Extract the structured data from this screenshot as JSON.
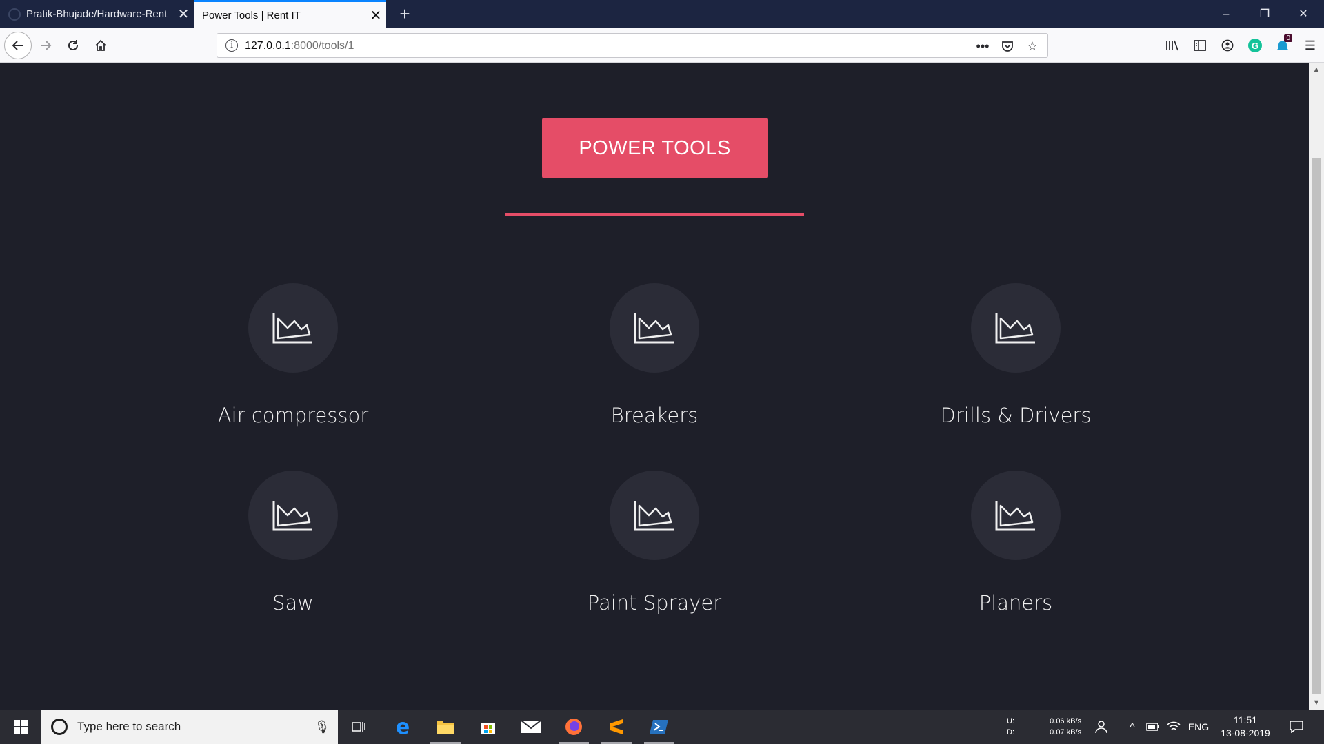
{
  "browser": {
    "tabs": [
      {
        "title": "Pratik-Bhujade/Hardware-Rent",
        "active": false
      },
      {
        "title": "Power Tools | Rent IT",
        "active": true
      }
    ],
    "url_host": "127.0.0.1",
    "url_path": ":8000/tools/1"
  },
  "page": {
    "heading": "POWER TOOLS",
    "accent_color": "#e54d67",
    "tools": [
      {
        "label": "Air compressor",
        "icon": "area-chart-icon"
      },
      {
        "label": "Breakers",
        "icon": "area-chart-icon"
      },
      {
        "label": "Drills & Drivers",
        "icon": "area-chart-icon"
      },
      {
        "label": "Saw",
        "icon": "area-chart-icon"
      },
      {
        "label": "Paint Sprayer",
        "icon": "area-chart-icon"
      },
      {
        "label": "Planers",
        "icon": "area-chart-icon"
      }
    ]
  },
  "taskbar": {
    "search_placeholder": "Type here to search",
    "net_up_label": "U:",
    "net_down_label": "D:",
    "net_up_value": "0.06 kB/s",
    "net_down_value": "0.07 kB/s",
    "language": "ENG",
    "time": "11:51",
    "date": "13-08-2019"
  },
  "extensions": {
    "badge_count": "0"
  }
}
